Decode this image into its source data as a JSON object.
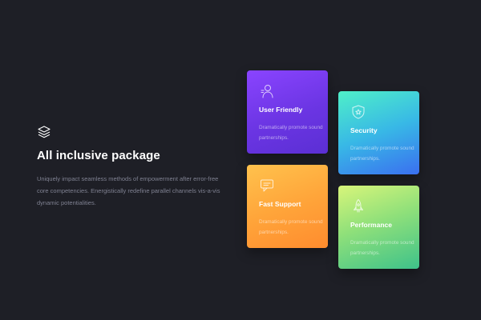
{
  "intro": {
    "icon": "layers-icon",
    "title": "All inclusive package",
    "description": "Uniquely impact seamless methods of empowerment after error-free core competencies. Energistically redefine parallel channels vis-a-vis dynamic potentialities."
  },
  "cards": [
    {
      "icon": "user-icon",
      "title": "User Friendly",
      "text": "Dramatically promote sound partnerships.",
      "colors": [
        "#8a44ff",
        "#5b2fd4"
      ]
    },
    {
      "icon": "shield-icon",
      "title": "Security",
      "text": "Dramatically promote sound partnerships.",
      "colors": [
        "#4ff0c8",
        "#3a6ff0"
      ]
    },
    {
      "icon": "chat-icon",
      "title": "Fast Support",
      "text": "Dramatically promote sound partnerships.",
      "colors": [
        "#ffc24d",
        "#ff8c2e"
      ]
    },
    {
      "icon": "rocket-icon",
      "title": "Performance",
      "text": "Dramatically promote sound partnerships.",
      "colors": [
        "#d8f57a",
        "#3ec28a"
      ]
    }
  ]
}
